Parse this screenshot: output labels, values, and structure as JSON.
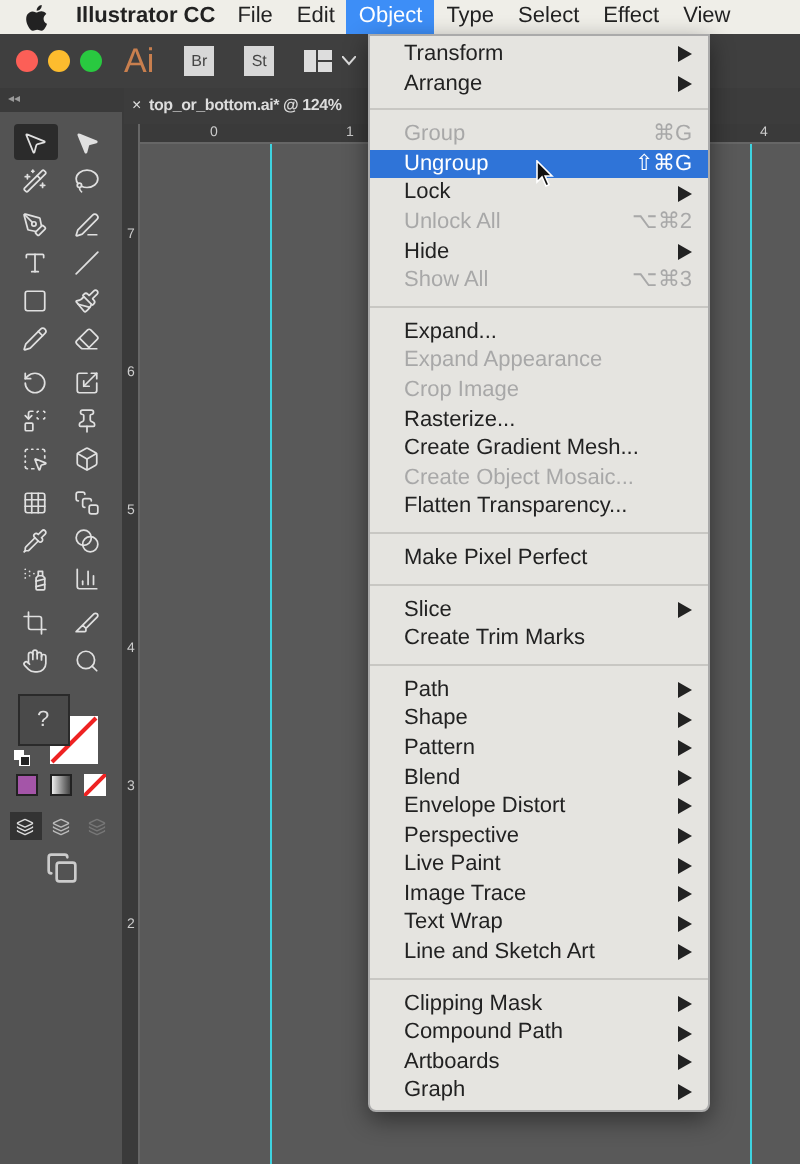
{
  "menubar": {
    "app": "Illustrator CC",
    "items": [
      {
        "label": "File",
        "selected": false
      },
      {
        "label": "Edit",
        "selected": false
      },
      {
        "label": "Object",
        "selected": true
      },
      {
        "label": "Type",
        "selected": false
      },
      {
        "label": "Select",
        "selected": false
      },
      {
        "label": "Effect",
        "selected": false
      },
      {
        "label": "View",
        "selected": false
      }
    ]
  },
  "appbar": {
    "logo": "Ai",
    "buttons": [
      "Br",
      "St"
    ]
  },
  "document_tab": {
    "close": "×",
    "title": "top_or_bottom.ai* @ 124%"
  },
  "toolbar": {
    "collapse": "◂◂",
    "tools": [
      {
        "selected": true
      },
      {
        "selected": false
      },
      {
        "selected": false
      },
      {
        "selected": false
      },
      {
        "selected": false
      },
      {
        "selected": false
      },
      {
        "selected": false
      },
      {
        "selected": false
      },
      {
        "selected": false
      },
      {
        "selected": false
      },
      {
        "selected": false
      },
      {
        "selected": false
      },
      {
        "selected": false
      },
      {
        "selected": false
      },
      {
        "selected": false
      },
      {
        "selected": false
      },
      {
        "selected": false
      },
      {
        "selected": false
      },
      {
        "selected": false
      },
      {
        "selected": false
      },
      {
        "selected": false
      },
      {
        "selected": false
      },
      {
        "selected": false
      },
      {
        "selected": false
      },
      {
        "selected": false
      },
      {
        "selected": false
      },
      {
        "selected": false
      },
      {
        "selected": false
      }
    ],
    "fill_label": "?"
  },
  "rulers": {
    "horizontal": [
      "0",
      "1",
      "4"
    ],
    "vertical": [
      "7",
      "6",
      "5",
      "4",
      "3",
      "2"
    ]
  },
  "menu": [
    {
      "kind": "item",
      "label": "Transform",
      "submenu": true,
      "disabled": false,
      "selected": false
    },
    {
      "kind": "item",
      "label": "Arrange",
      "submenu": true,
      "disabled": false,
      "selected": false
    },
    {
      "kind": "separator"
    },
    {
      "kind": "item",
      "label": "Group",
      "shortcut": "⌘G",
      "submenu": false,
      "disabled": true,
      "selected": false
    },
    {
      "kind": "item",
      "label": "Ungroup",
      "shortcut": "⇧⌘G",
      "submenu": false,
      "disabled": false,
      "selected": true
    },
    {
      "kind": "item",
      "label": "Lock",
      "submenu": true,
      "disabled": false,
      "selected": false
    },
    {
      "kind": "item",
      "label": "Unlock All",
      "shortcut": "⌥⌘2",
      "submenu": false,
      "disabled": true,
      "selected": false
    },
    {
      "kind": "item",
      "label": "Hide",
      "submenu": true,
      "disabled": false,
      "selected": false
    },
    {
      "kind": "item",
      "label": "Show All",
      "shortcut": "⌥⌘3",
      "submenu": false,
      "disabled": true,
      "selected": false
    },
    {
      "kind": "separator"
    },
    {
      "kind": "item",
      "label": "Expand...",
      "submenu": false,
      "disabled": false,
      "selected": false
    },
    {
      "kind": "item",
      "label": "Expand Appearance",
      "submenu": false,
      "disabled": true,
      "selected": false
    },
    {
      "kind": "item",
      "label": "Crop Image",
      "submenu": false,
      "disabled": true,
      "selected": false
    },
    {
      "kind": "item",
      "label": "Rasterize...",
      "submenu": false,
      "disabled": false,
      "selected": false
    },
    {
      "kind": "item",
      "label": "Create Gradient Mesh...",
      "submenu": false,
      "disabled": false,
      "selected": false
    },
    {
      "kind": "item",
      "label": "Create Object Mosaic...",
      "submenu": false,
      "disabled": true,
      "selected": false
    },
    {
      "kind": "item",
      "label": "Flatten Transparency...",
      "submenu": false,
      "disabled": false,
      "selected": false
    },
    {
      "kind": "separator"
    },
    {
      "kind": "item",
      "label": "Make Pixel Perfect",
      "submenu": false,
      "disabled": false,
      "selected": false
    },
    {
      "kind": "separator"
    },
    {
      "kind": "item",
      "label": "Slice",
      "submenu": true,
      "disabled": false,
      "selected": false
    },
    {
      "kind": "item",
      "label": "Create Trim Marks",
      "submenu": false,
      "disabled": false,
      "selected": false
    },
    {
      "kind": "separator"
    },
    {
      "kind": "item",
      "label": "Path",
      "submenu": true,
      "disabled": false,
      "selected": false
    },
    {
      "kind": "item",
      "label": "Shape",
      "submenu": true,
      "disabled": false,
      "selected": false
    },
    {
      "kind": "item",
      "label": "Pattern",
      "submenu": true,
      "disabled": false,
      "selected": false
    },
    {
      "kind": "item",
      "label": "Blend",
      "submenu": true,
      "disabled": false,
      "selected": false
    },
    {
      "kind": "item",
      "label": "Envelope Distort",
      "submenu": true,
      "disabled": false,
      "selected": false
    },
    {
      "kind": "item",
      "label": "Perspective",
      "submenu": true,
      "disabled": false,
      "selected": false
    },
    {
      "kind": "item",
      "label": "Live Paint",
      "submenu": true,
      "disabled": false,
      "selected": false
    },
    {
      "kind": "item",
      "label": "Image Trace",
      "submenu": true,
      "disabled": false,
      "selected": false
    },
    {
      "kind": "item",
      "label": "Text Wrap",
      "submenu": true,
      "disabled": false,
      "selected": false
    },
    {
      "kind": "item",
      "label": "Line and Sketch Art",
      "submenu": true,
      "disabled": false,
      "selected": false
    },
    {
      "kind": "separator"
    },
    {
      "kind": "item",
      "label": "Clipping Mask",
      "submenu": true,
      "disabled": false,
      "selected": false
    },
    {
      "kind": "item",
      "label": "Compound Path",
      "submenu": true,
      "disabled": false,
      "selected": false
    },
    {
      "kind": "item",
      "label": "Artboards",
      "submenu": true,
      "disabled": false,
      "selected": false
    },
    {
      "kind": "item",
      "label": "Graph",
      "submenu": true,
      "disabled": false,
      "selected": false
    }
  ]
}
